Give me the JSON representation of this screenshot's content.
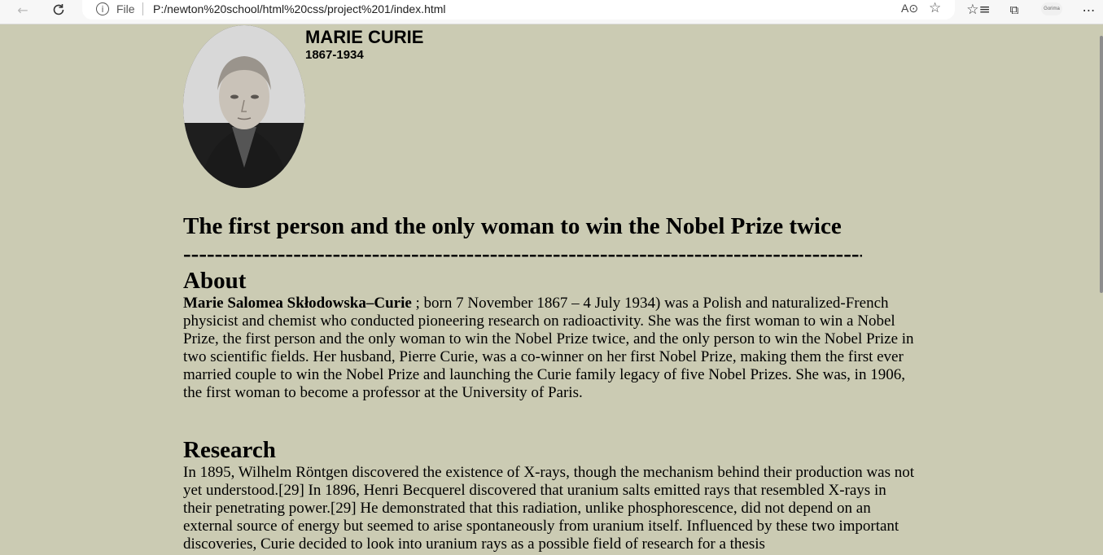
{
  "browser": {
    "scheme": "File",
    "url": "P:/newton%20school/html%20css/project%201/index.html",
    "profile_label": "Gorima"
  },
  "profile": {
    "name": "MARIE CURIE",
    "years": "1867-1934"
  },
  "headline": "The first person and the only woman to win the Nobel Prize twice",
  "separator": "--------------------------------------------------------------------------------------------------------",
  "about": {
    "heading": "About",
    "full_name": "Marie Salomea Skłodowska–Curie",
    "text": " ; born 7 November 1867 – 4 July 1934) was a Polish and naturalized-French physicist and chemist who conducted pioneering research on radioactivity. She was the first woman to win a Nobel Prize, the first person and the only woman to win the Nobel Prize twice, and the only person to win the Nobel Prize in two scientific fields. Her husband, Pierre Curie, was a co-winner on her first Nobel Prize, making them the first ever married couple to win the Nobel Prize and launching the Curie family legacy of five Nobel Prizes. She was, in 1906, the first woman to become a professor at the University of Paris."
  },
  "research": {
    "heading": "Research",
    "text": "In 1895, Wilhelm Röntgen discovered the existence of X-rays, though the mechanism behind their production was not yet understood.[29] In 1896, Henri Becquerel discovered that uranium salts emitted rays that resembled X-rays in their penetrating power.[29] He demonstrated that this radiation, unlike phosphorescence, did not depend on an external source of energy but seemed to arise spontaneously from uranium itself. Influenced by these two important discoveries, Curie decided to look into uranium rays as a possible field of research for a thesis"
  }
}
